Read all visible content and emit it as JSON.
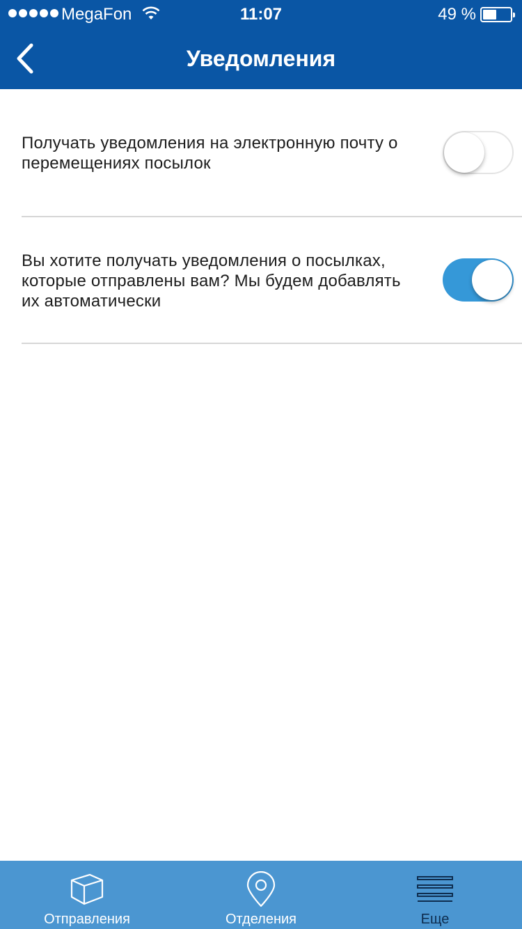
{
  "status_bar": {
    "carrier": "MegaFon",
    "time": "11:07",
    "battery_percent": "49 %",
    "battery_level": 0.49
  },
  "header": {
    "title": "Уведомления",
    "back_icon": "chevron-left-icon"
  },
  "settings": [
    {
      "label": "Получать уведомления на электронную почту о перемещениях посылок",
      "enabled": false
    },
    {
      "label": "Вы хотите получать уведомления о посылках, которые отправлены вам? Мы будем добавлять их автоматически",
      "enabled": true
    }
  ],
  "tabbar": {
    "tabs": [
      {
        "label": "Отправления",
        "icon": "box-icon",
        "active": false
      },
      {
        "label": "Отделения",
        "icon": "location-pin-icon",
        "active": false
      },
      {
        "label": "Еще",
        "icon": "menu-icon",
        "active": true
      }
    ]
  },
  "colors": {
    "header_bg": "#0a56a5",
    "toggle_on": "#3598d8",
    "tabbar_bg": "#4b96d1",
    "tab_active": "#0e2d4f"
  }
}
